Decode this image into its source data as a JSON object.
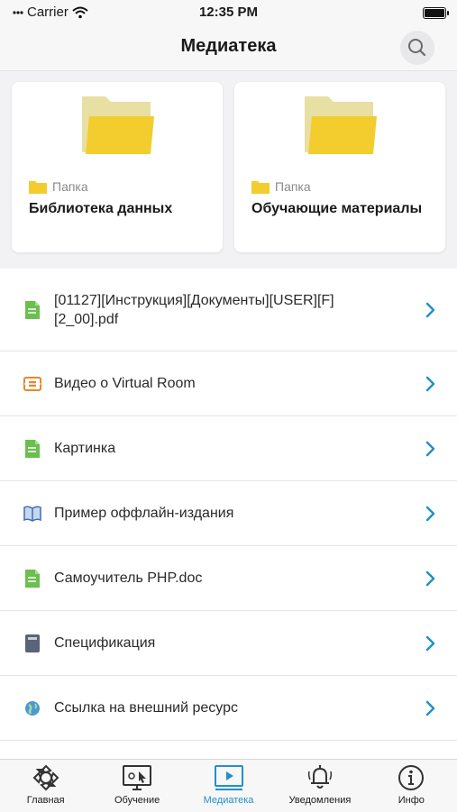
{
  "status_bar": {
    "carrier": "Carrier",
    "time": "12:35 PM"
  },
  "header": {
    "title": "Медиатека"
  },
  "folders": [
    {
      "kind": "Папка",
      "name": "Библиотека данных"
    },
    {
      "kind": "Папка",
      "name": "Обучающие материалы"
    }
  ],
  "items": [
    {
      "label": "[01127][Инструкция][Документы][USER][F][2_00].pdf",
      "icon": "document-icon"
    },
    {
      "label": "Видео о Virtual Room",
      "icon": "video-link-icon"
    },
    {
      "label": "Картинка",
      "icon": "document-icon"
    },
    {
      "label": "Пример оффлайн-издания",
      "icon": "book-icon"
    },
    {
      "label": "Самоучитель PHP.doc",
      "icon": "document-icon"
    },
    {
      "label": "Спецификация",
      "icon": "notebook-icon"
    },
    {
      "label": "Ссылка на внешний ресурс",
      "icon": "globe-icon"
    }
  ],
  "tabs": [
    {
      "label": "Главная",
      "icon": "home-icon"
    },
    {
      "label": "Обучение",
      "icon": "learning-icon"
    },
    {
      "label": "Медиатека",
      "icon": "media-icon"
    },
    {
      "label": "Уведомления",
      "icon": "bell-icon"
    },
    {
      "label": "Инфо",
      "icon": "info-icon"
    }
  ],
  "colors": {
    "accent": "#2390c9",
    "folder": "#f2cd2d",
    "doc": "#6cbf4f",
    "orange": "#e8862a"
  }
}
